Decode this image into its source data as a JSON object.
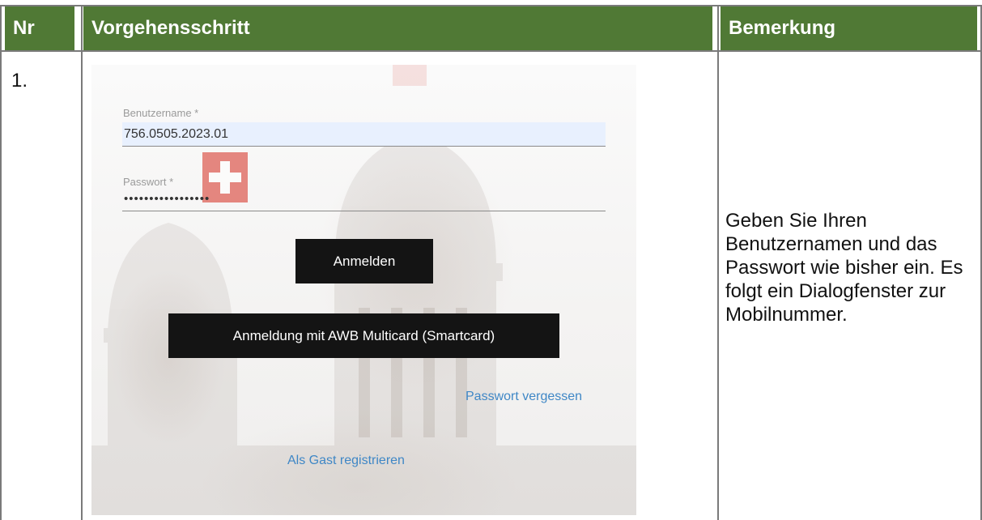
{
  "table": {
    "headers": {
      "nr": "Nr",
      "step": "Vorgehensschritt",
      "remark": "Bemerkung"
    },
    "row": {
      "nr": "1.",
      "remark": "Geben Sie Ihren Benutzernamen und das Passwort wie bisher ein. Es folgt ein Dialogfenster zur Mobilnummer."
    }
  },
  "login": {
    "username_label": "Benutzername *",
    "username_value": "756.0505.2023.01",
    "password_label": "Passwort *",
    "password_value": "•••••••••••••••••",
    "login_button": "Anmelden",
    "smartcard_button": "Anmeldung mit AWB Multicard (Smartcard)",
    "forgot_link": "Passwort vergessen",
    "guest_link": "Als Gast registrieren"
  },
  "colors": {
    "header_bg": "#507935",
    "link": "#3f87c6",
    "button_bg": "#141414",
    "flag_red": "#d52b1e"
  }
}
